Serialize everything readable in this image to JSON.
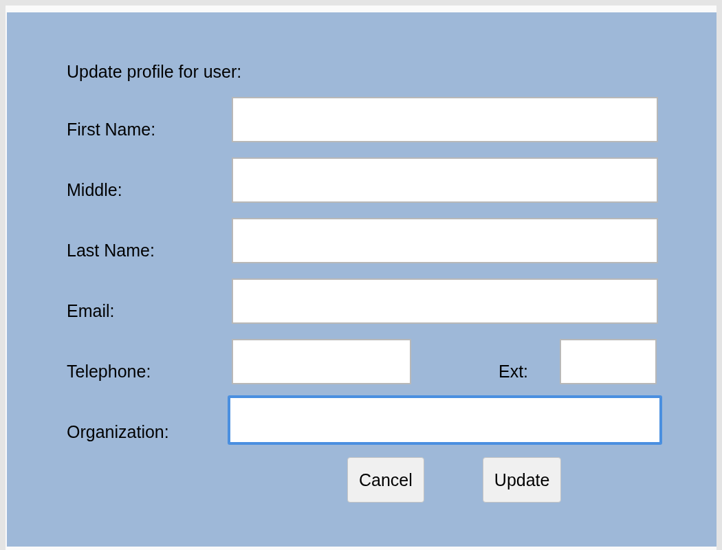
{
  "title": "Update profile for user:",
  "fields": [
    {
      "label": "First Name:",
      "focused": false
    },
    {
      "label": "Middle:",
      "focused": false
    },
    {
      "label": "Last Name:",
      "focused": false
    },
    {
      "label": "Email:",
      "focused": false
    }
  ],
  "telephone": {
    "label": "Telephone:",
    "focused": false,
    "ext_label": "Ext:",
    "ext_focused": false
  },
  "organization": {
    "label": "Organization:",
    "focused": true
  },
  "buttons": [
    "Cancel",
    "Update"
  ]
}
